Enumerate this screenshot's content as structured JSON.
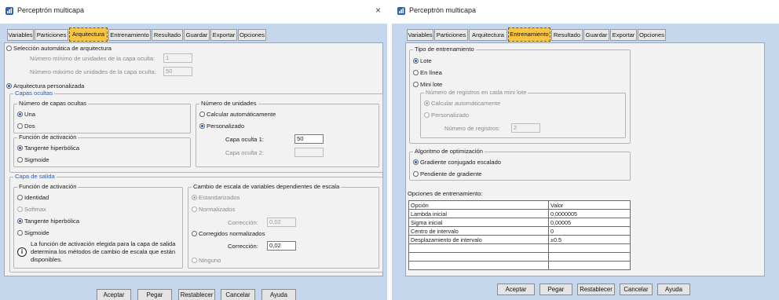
{
  "left_dialog": {
    "title": "Perceptrón multicapa",
    "close_glyph": "×",
    "tabs": [
      "Variables",
      "Particiones",
      "Arquitectura",
      "Entrenamiento",
      "Resultado",
      "Guardar",
      "Exportar",
      "Opciones"
    ],
    "active_tab": "Arquitectura",
    "auto_arch": {
      "label": "Selección automática de arquitectura",
      "min_label": "Número mínimo de unidades de la capa oculta:",
      "min_value": "1",
      "max_label": "Número máximo de unidades de la capa oculta:",
      "max_value": "50"
    },
    "custom_arch": {
      "label": "Arquitectura personalizada",
      "hidden_layers_title": "Capas ocultas",
      "num_layers": {
        "legend": "Número de capas ocultas",
        "one": "Una",
        "two": "Dos"
      },
      "num_units": {
        "legend": "Número de unidades",
        "auto": "Calcular automáticamente",
        "custom": "Personalizado",
        "layer1_label": "Capa oculta 1:",
        "layer1_value": "50",
        "layer2_label": "Capa oculta 2:",
        "layer2_value": ""
      },
      "hidden_activation": {
        "legend": "Función de activación",
        "tanh": "Tangente hiperbólica",
        "sigmoid": "Sigmoide"
      },
      "output_layer_title": "Capa de salida",
      "output_activation": {
        "legend": "Función de activación",
        "identity": "Identidad",
        "softmax": "Softmax",
        "tanh": "Tangente hiperbólica",
        "sigmoid": "Sigmoide",
        "info_glyph": "i",
        "info_lines": [
          "La función de activación elegida para la capa de salida",
          "determina los métodos de cambio de escala que están",
          "disponibles."
        ]
      },
      "rescale": {
        "legend": "Cambio de escala de variables dependientes de escala",
        "standardized": "Estandarizados",
        "normalized": "Normalizados",
        "correction_label_1": "Corrección:",
        "correction_value_1": "0,02",
        "adjusted_normalized": "Corregidos normalizados",
        "correction_label_2": "Corrección:",
        "correction_value_2": "0,02",
        "none": "Ninguno"
      }
    },
    "buttons": [
      "Aceptar",
      "Pegar",
      "Restablecer",
      "Cancelar",
      "Ayuda"
    ]
  },
  "right_dialog": {
    "title": "Perceptrón multicapa",
    "tabs": [
      "Variables",
      "Particiones",
      "Arquitectura",
      "Entrenamiento",
      "Resultado",
      "Guardar",
      "Exportar",
      "Opciones"
    ],
    "active_tab": "Entrenamiento",
    "training_type": {
      "legend": "Tipo de entrenamiento",
      "batch": "Lote",
      "online": "En línea",
      "minibatch": "Mini lote",
      "records": {
        "legend": "Número de registros en cada mini lote",
        "auto": "Calcular automáticamente",
        "custom": "Personalizado",
        "num_label": "Número de registros:",
        "num_value": "2"
      }
    },
    "optimization": {
      "legend": "Algoritmo de optimización",
      "scaled_conjugate": "Gradiente conjugado escalado",
      "gradient_descent": "Pendiente de gradiente"
    },
    "options_table": {
      "caption": "Opciones de entrenamiento:",
      "headers": [
        "Opción",
        "Valor"
      ],
      "rows": [
        [
          "Lambda inicial",
          "0,0000005"
        ],
        [
          "Sigma inicial",
          "0,00005"
        ],
        [
          "Centro de intervalo",
          "0"
        ],
        [
          "Desplazamiento de intervalo",
          "±0.5"
        ],
        [
          "",
          ""
        ],
        [
          "",
          ""
        ],
        [
          "",
          ""
        ]
      ]
    },
    "buttons": [
      "Aceptar",
      "Pegar",
      "Restablecer",
      "Cancelar",
      "Ayuda"
    ]
  },
  "colors": {
    "dialog_bg": "#c5d7ec",
    "active_tab": "#f7c443",
    "panel_bg": "#f2f2f2"
  }
}
